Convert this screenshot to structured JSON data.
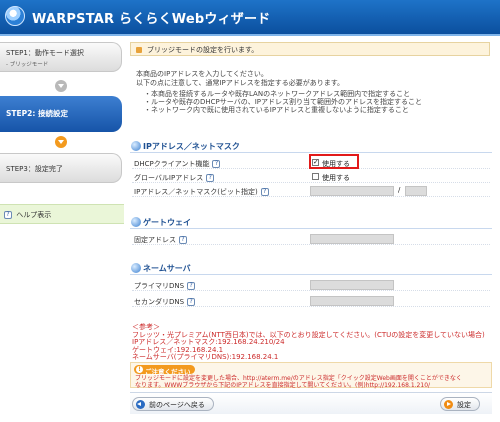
{
  "header": {
    "title": "WARPSTAR らくらくWebウィザード"
  },
  "sidebar": {
    "step1": {
      "label": "STEP1：動作モード選択",
      "sub": "- ブリッジモード"
    },
    "step2": {
      "label": "STEP2: 接続設定"
    },
    "step3": {
      "label": "STEP3：設定完了"
    },
    "help": {
      "label": "ヘルプ表示",
      "icon_text": "?"
    }
  },
  "main": {
    "page_head": "ブリッジモードの設定を行います。",
    "intro": [
      "本商品のIPアドレスを入力してください。",
      "以下の点に注意して、通常IPアドレスを指定する必要があります。"
    ],
    "bullets": [
      "・本商品を接続するルータや既存LANのネットワークアドレス範囲内で指定すること",
      "・ルータや既存のDHCPサーバの、IPアドレス割り当て範囲外のアドレスを指定すること",
      "・ネットワーク内で既に使用されているIPアドレスと重複しないように指定すること"
    ],
    "sections": {
      "ip": "IPアドレス／ネットマスク",
      "gateway": "ゲートウェイ",
      "dns": "ネームサーバ"
    },
    "rows": {
      "dhcp": {
        "label": "DHCPクライアント機能",
        "checkbox": "使用する",
        "checked": true
      },
      "global_ip": {
        "label": "グローバルIPアドレス",
        "checkbox": "使用する",
        "checked": false
      },
      "ip_mask": {
        "label": "IPアドレス／ネットマスク(ビット指定)",
        "separator": "/"
      },
      "fixed": {
        "label": "固定アドレス"
      },
      "primary_dns": {
        "label": "プライマリDNS"
      },
      "secondary_dns": {
        "label": "セカンダリDNS"
      }
    },
    "help_icon": "?",
    "notes": [
      "＜参考＞",
      "フレッツ・光プレミアム(NTT西日本)では、以下のとおり設定してください。(CTUの設定を変更していない場合)",
      "IPアドレス／ネットマスク:192.168.24.210/24",
      "ゲートウェイ:192.168.24.1",
      "ネームサーバ(プライマリDNS):192.168.24.1"
    ],
    "notice": {
      "title": "ご注意ください",
      "text": [
        "ブリッジモードに設定を変更した場合、http://aterm.me/のアドレス指定「クイック設定Web画面を開くことができなく",
        "なります。WWWブラウザから下記のIPアドレスを直接指定して開いてください。(例)http://192.168.1.210/"
      ]
    },
    "buttons": {
      "back": "前のページへ戻る",
      "next": "設定"
    }
  }
}
